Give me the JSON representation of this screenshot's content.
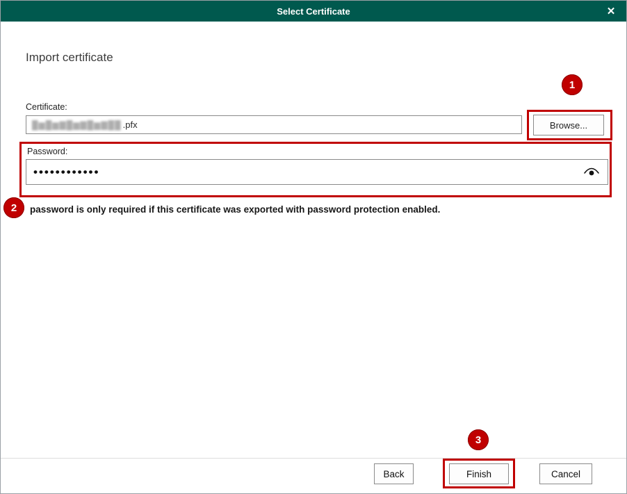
{
  "window": {
    "title": "Select Certificate",
    "close_glyph": "✕"
  },
  "page": {
    "heading": "Import certificate"
  },
  "certificate": {
    "label": "Certificate:",
    "redacted_value": "█▆█▆▇█▆▇█▆▇██",
    "value_suffix": ".pfx",
    "browse_label": "Browse..."
  },
  "password": {
    "label": "Password:",
    "masked_value": "••••••••••••",
    "eye_icon_name": "reveal-password-eye-icon"
  },
  "hint": "password is only required if this certificate was exported with password protection enabled.",
  "buttons": {
    "back": "Back",
    "finish": "Finish",
    "cancel": "Cancel"
  },
  "annotations": {
    "badge1": "1",
    "badge2": "2",
    "badge3": "3",
    "color": "#c00000"
  },
  "colors": {
    "titlebar": "#00594e"
  }
}
